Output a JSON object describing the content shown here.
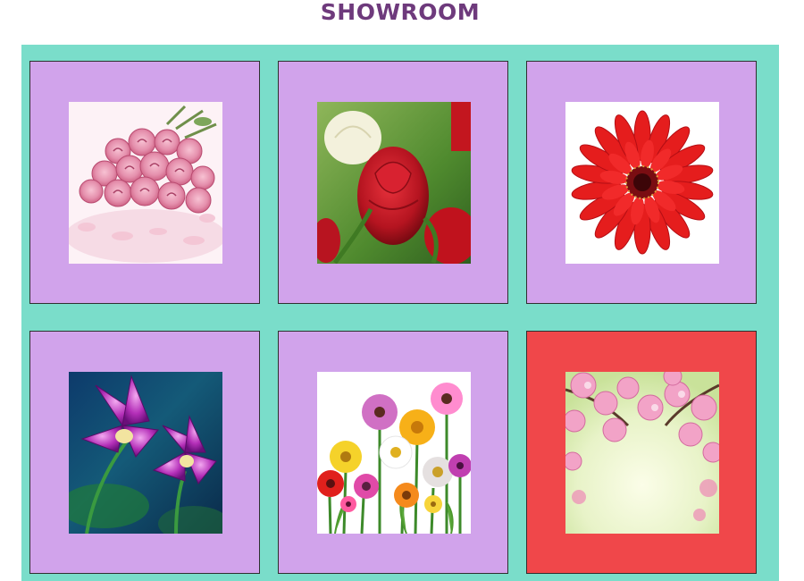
{
  "header": {
    "title": "SHOWROOM"
  },
  "colors": {
    "title": "#6e3a7c",
    "gallery_background": "#7addca",
    "card_background": "#d1a3eb",
    "card_selected_background": "#f0474a"
  },
  "gallery": {
    "items": [
      {
        "icon": "pink-roses-bouquet-icon",
        "selected": false
      },
      {
        "icon": "red-and-white-roses-icon",
        "selected": false
      },
      {
        "icon": "red-gerbera-icon",
        "selected": false
      },
      {
        "icon": "purple-orchids-icon",
        "selected": false
      },
      {
        "icon": "colorful-daisies-icon",
        "selected": false
      },
      {
        "icon": "cherry-blossom-icon",
        "selected": true
      }
    ]
  }
}
